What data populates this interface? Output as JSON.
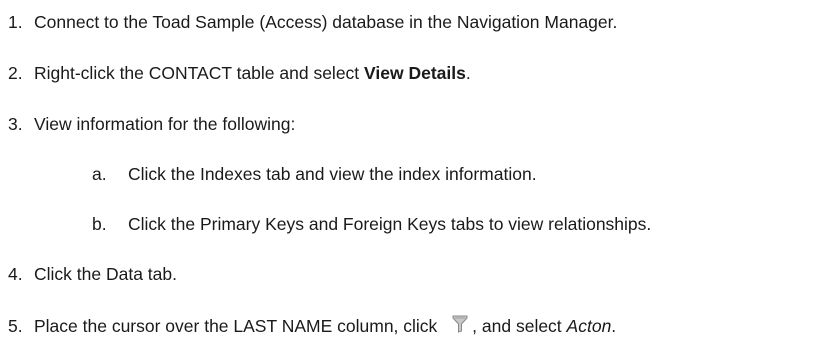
{
  "steps": [
    {
      "number": "1.",
      "text": "Connect to the Toad Sample (Access) database in the Navigation Manager."
    },
    {
      "number": "2.",
      "text_before": "Right-click the CONTACT table and select ",
      "bold": "View Details",
      "text_after": "."
    },
    {
      "number": "3.",
      "text": "View information for the following:",
      "substeps": [
        {
          "letter": "a.",
          "text": "Click the Indexes tab and view the index information."
        },
        {
          "letter": "b.",
          "text": "Click the Primary Keys and Foreign Keys tabs to view relationships."
        }
      ]
    },
    {
      "number": "4.",
      "text": "Click the Data tab."
    },
    {
      "number": "5.",
      "text_before": "Place the cursor over the LAST  NAME column, click ",
      "icon": "filter-icon",
      "text_middle": ", and select ",
      "italic": "Acton",
      "text_after": "."
    }
  ],
  "colors": {
    "text": "#1a1a1a",
    "icon_fill": "#c8c8c8",
    "icon_stroke": "#8a8a8a"
  }
}
